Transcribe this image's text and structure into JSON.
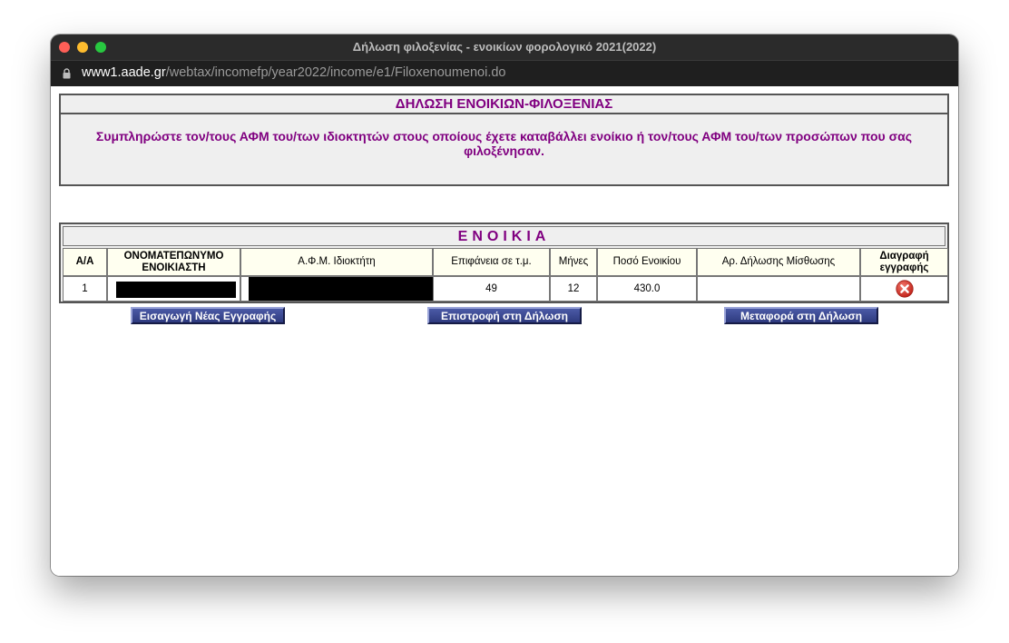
{
  "window": {
    "title": "Δήλωση φιλοξενίας - ενοικίων φορολογικό 2021(2022)",
    "url_domain": "www1.aade.gr",
    "url_path": "/webtax/incomefp/year2022/income/e1/Filoxenoumenoi.do"
  },
  "form": {
    "title": "ΔΗΛΩΣΗ ΕΝΟΙΚΙΩΝ-ΦΙΛΟΞΕΝΙΑΣ",
    "description": "Συμπληρώστε τον/τους ΑΦΜ του/των ιδιοκτητών στους οποίους έχετε καταβάλλει ενοίκιο ή τον/τους ΑΦΜ του/των προσώπων που σας φιλοξένησαν."
  },
  "rentals": {
    "title": "ΕΝΟΙΚΙΑ",
    "headers": {
      "aa": "Α/Α",
      "name": "ΟΝΟΜΑΤΕΠΩΝΥΜΟ ΕΝΟΙΚΙΑΣΤΗ",
      "afm": "Α.Φ.Μ. Ιδιοκτήτη",
      "area": "Επιφάνεια σε τ.μ.",
      "months": "Μήνες",
      "amount": "Ποσό Ενοικίου",
      "lease_no": "Αρ. Δήλωσης Μίσθωσης",
      "delete": "Διαγραφή εγγραφής"
    },
    "rows": [
      {
        "aa": "1",
        "name": "",
        "afm": "",
        "area": "49",
        "months": "12",
        "amount": "430.0",
        "lease_no": ""
      }
    ]
  },
  "buttons": {
    "new_entry": "Εισαγωγή Νέας Εγγραφής",
    "return": "Επιστροφή στη Δήλωση",
    "transfer": "Μεταφορά στη Δήλωση"
  },
  "icons": {
    "lock": "lock-icon",
    "delete": "delete-x-icon"
  },
  "colors": {
    "heading": "#800080",
    "button": "#3a4690",
    "header_cell": "#fffff0",
    "delete_icon": "#d9342b"
  }
}
